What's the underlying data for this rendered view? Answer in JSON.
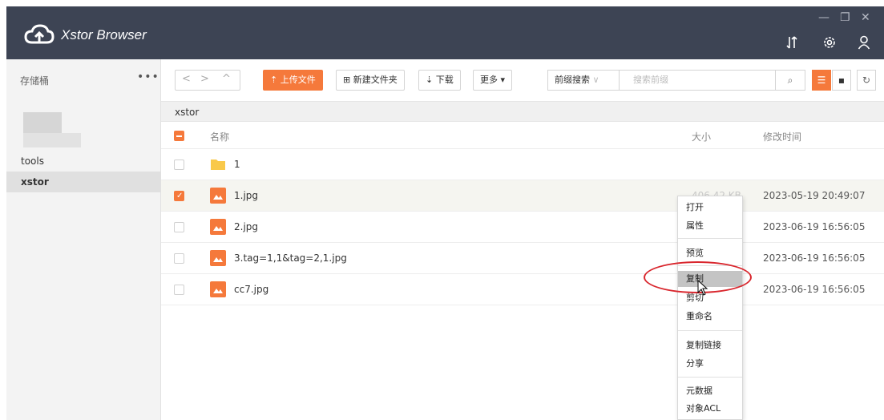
{
  "window": {
    "title": "Xstor Browser",
    "controls": {
      "minimize": "—",
      "restore": "❐",
      "close": "✕"
    },
    "icons": [
      "transfer-icon",
      "settings-icon",
      "user-icon"
    ]
  },
  "sidebar": {
    "header": "存储桶",
    "more": "•••",
    "items": [
      {
        "label": "tools",
        "active": false
      },
      {
        "label": "xstor",
        "active": true
      }
    ]
  },
  "toolbar": {
    "upload_label": "上传文件",
    "new_folder_label": "新建文件夹",
    "download_label": "下载",
    "more_label": "更多",
    "search_mode": "前缀搜索",
    "search_placeholder": "搜索前缀"
  },
  "path": "xstor",
  "table": {
    "columns": {
      "name": "名称",
      "size": "大小",
      "modified": "修改时间"
    },
    "rows": [
      {
        "type": "folder",
        "name": "1",
        "size": "",
        "modified": "",
        "checked": false
      },
      {
        "type": "image",
        "name": "1.jpg",
        "size": "406.42 KB",
        "modified": "2023-05-19 20:49:07",
        "checked": true
      },
      {
        "type": "image",
        "name": "2.jpg",
        "size": "",
        "modified": "2023-06-19 16:56:05",
        "checked": false
      },
      {
        "type": "image",
        "name": "3.tag=1,1&tag=2,1.jpg",
        "size": "",
        "modified": "2023-06-19 16:56:05",
        "checked": false
      },
      {
        "type": "image",
        "name": "cc7.jpg",
        "size": "",
        "modified": "2023-06-19 16:56:05",
        "checked": false
      }
    ]
  },
  "context_menu": {
    "items": [
      "打开",
      "属性",
      "预览",
      "复制",
      "剪切",
      "重命名",
      "复制链接",
      "分享",
      "元数据",
      "对象ACL"
    ],
    "highlighted": "复制"
  },
  "colors": {
    "accent": "#f5793b",
    "titlebar": "#3d4454",
    "annotation": "#d9272e"
  }
}
